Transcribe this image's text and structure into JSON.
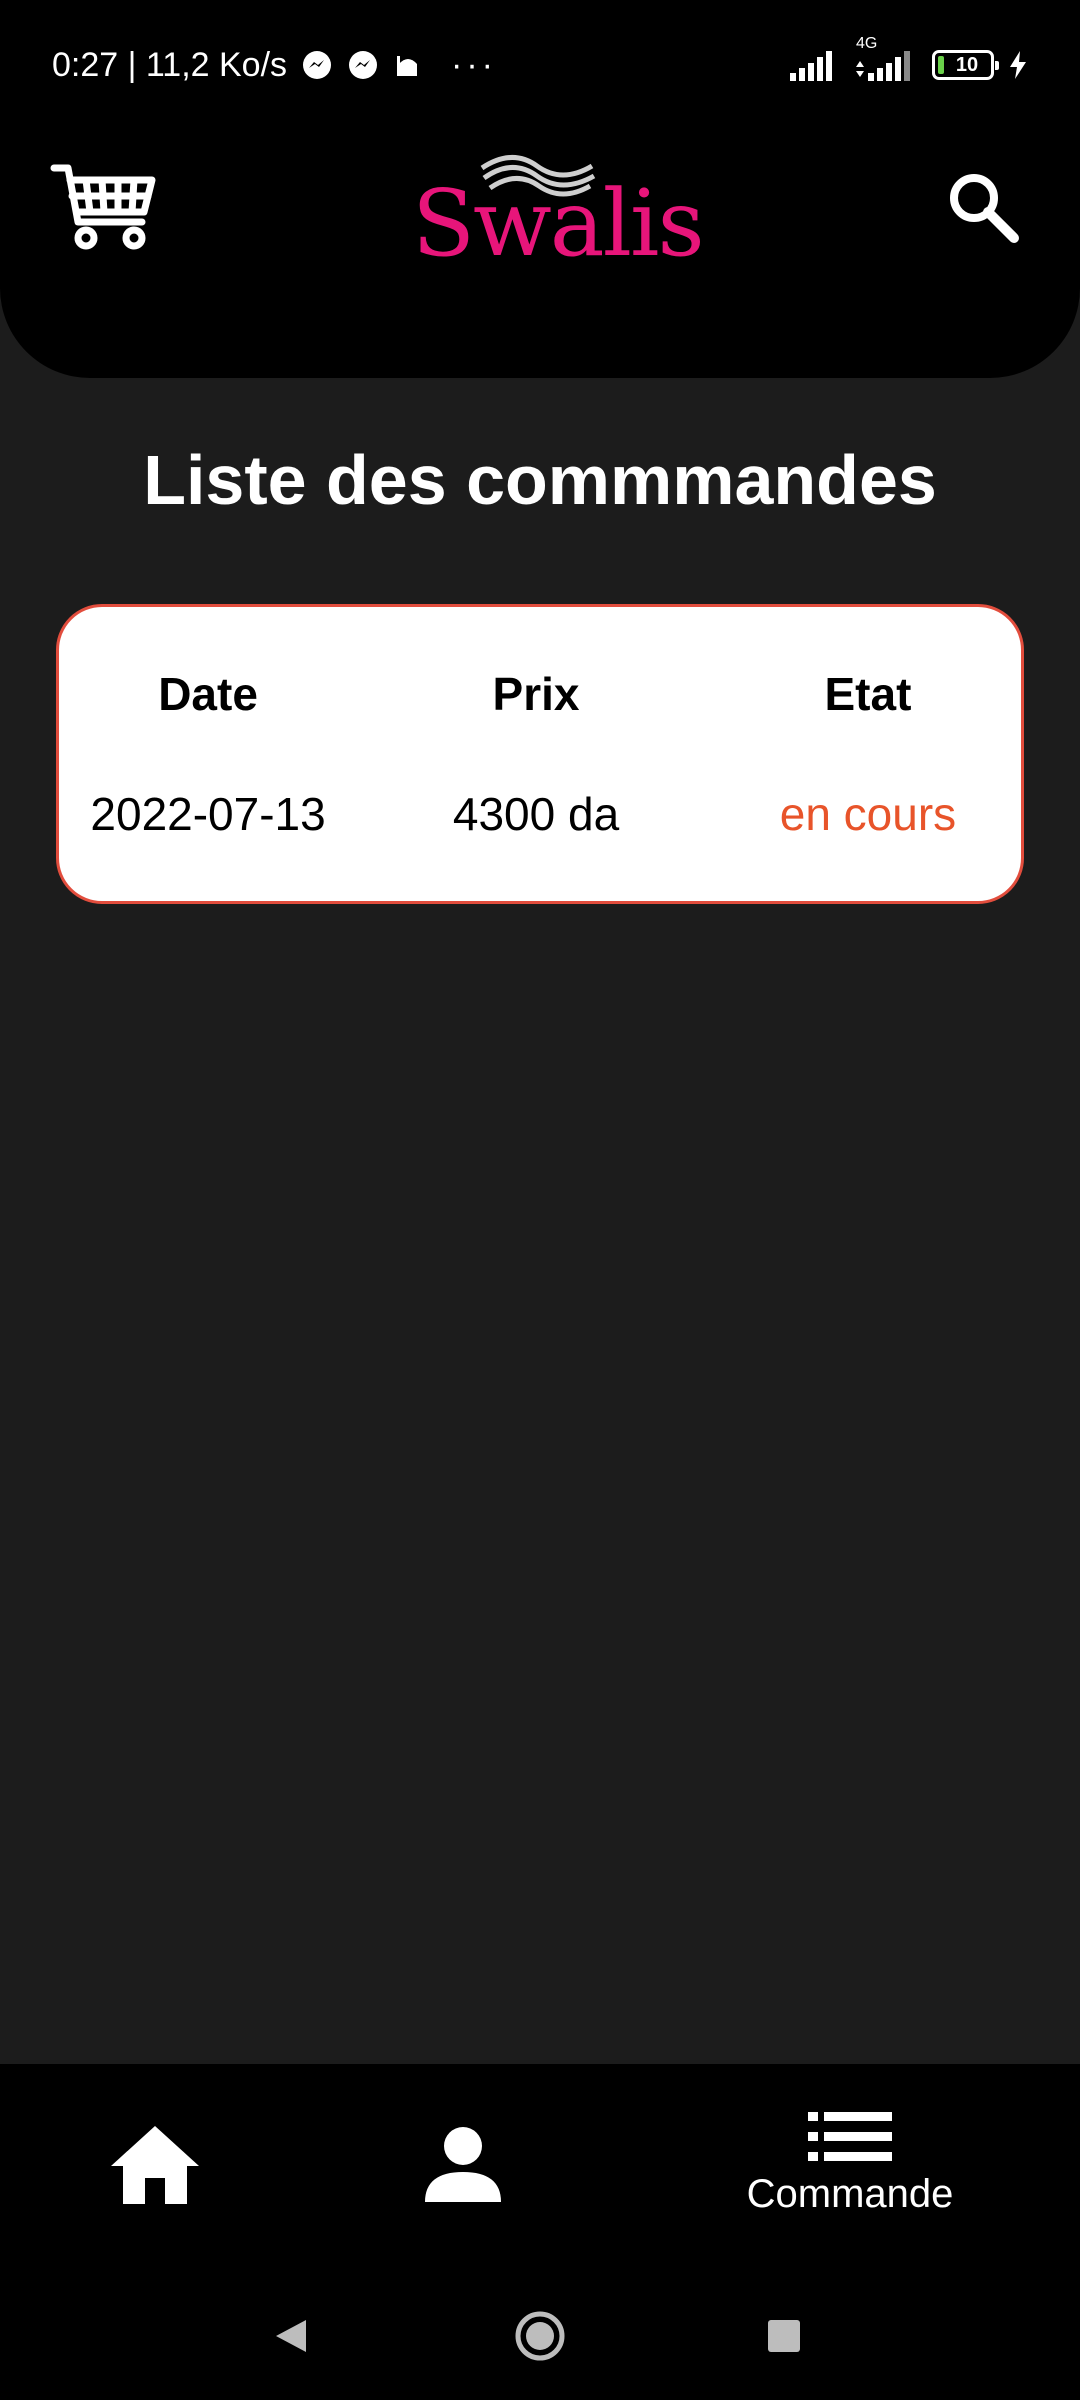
{
  "status_bar": {
    "time_speed": "0:27 | 11,2 Ko/s",
    "more": "···",
    "network_type": "4G",
    "battery": "10"
  },
  "header": {
    "logo_text": "Swalis",
    "cart_icon": "cart-icon",
    "search_icon": "search-icon"
  },
  "page": {
    "title": "Liste des commmandes"
  },
  "orders_table": {
    "columns": [
      "Date",
      "Prix",
      "Etat"
    ],
    "rows": [
      {
        "date": "2022-07-13",
        "prix": "4300 da",
        "etat": "en cours"
      }
    ],
    "status_color": "#e8542a",
    "border_color": "#e24d3d"
  },
  "bottom_nav": {
    "items": [
      {
        "icon": "home-icon",
        "label": ""
      },
      {
        "icon": "person-icon",
        "label": ""
      },
      {
        "icon": "list-icon",
        "label": "Commande"
      }
    ]
  },
  "colors": {
    "brand": "#e7157a",
    "background": "#1c1c1c",
    "bar": "#000000"
  }
}
